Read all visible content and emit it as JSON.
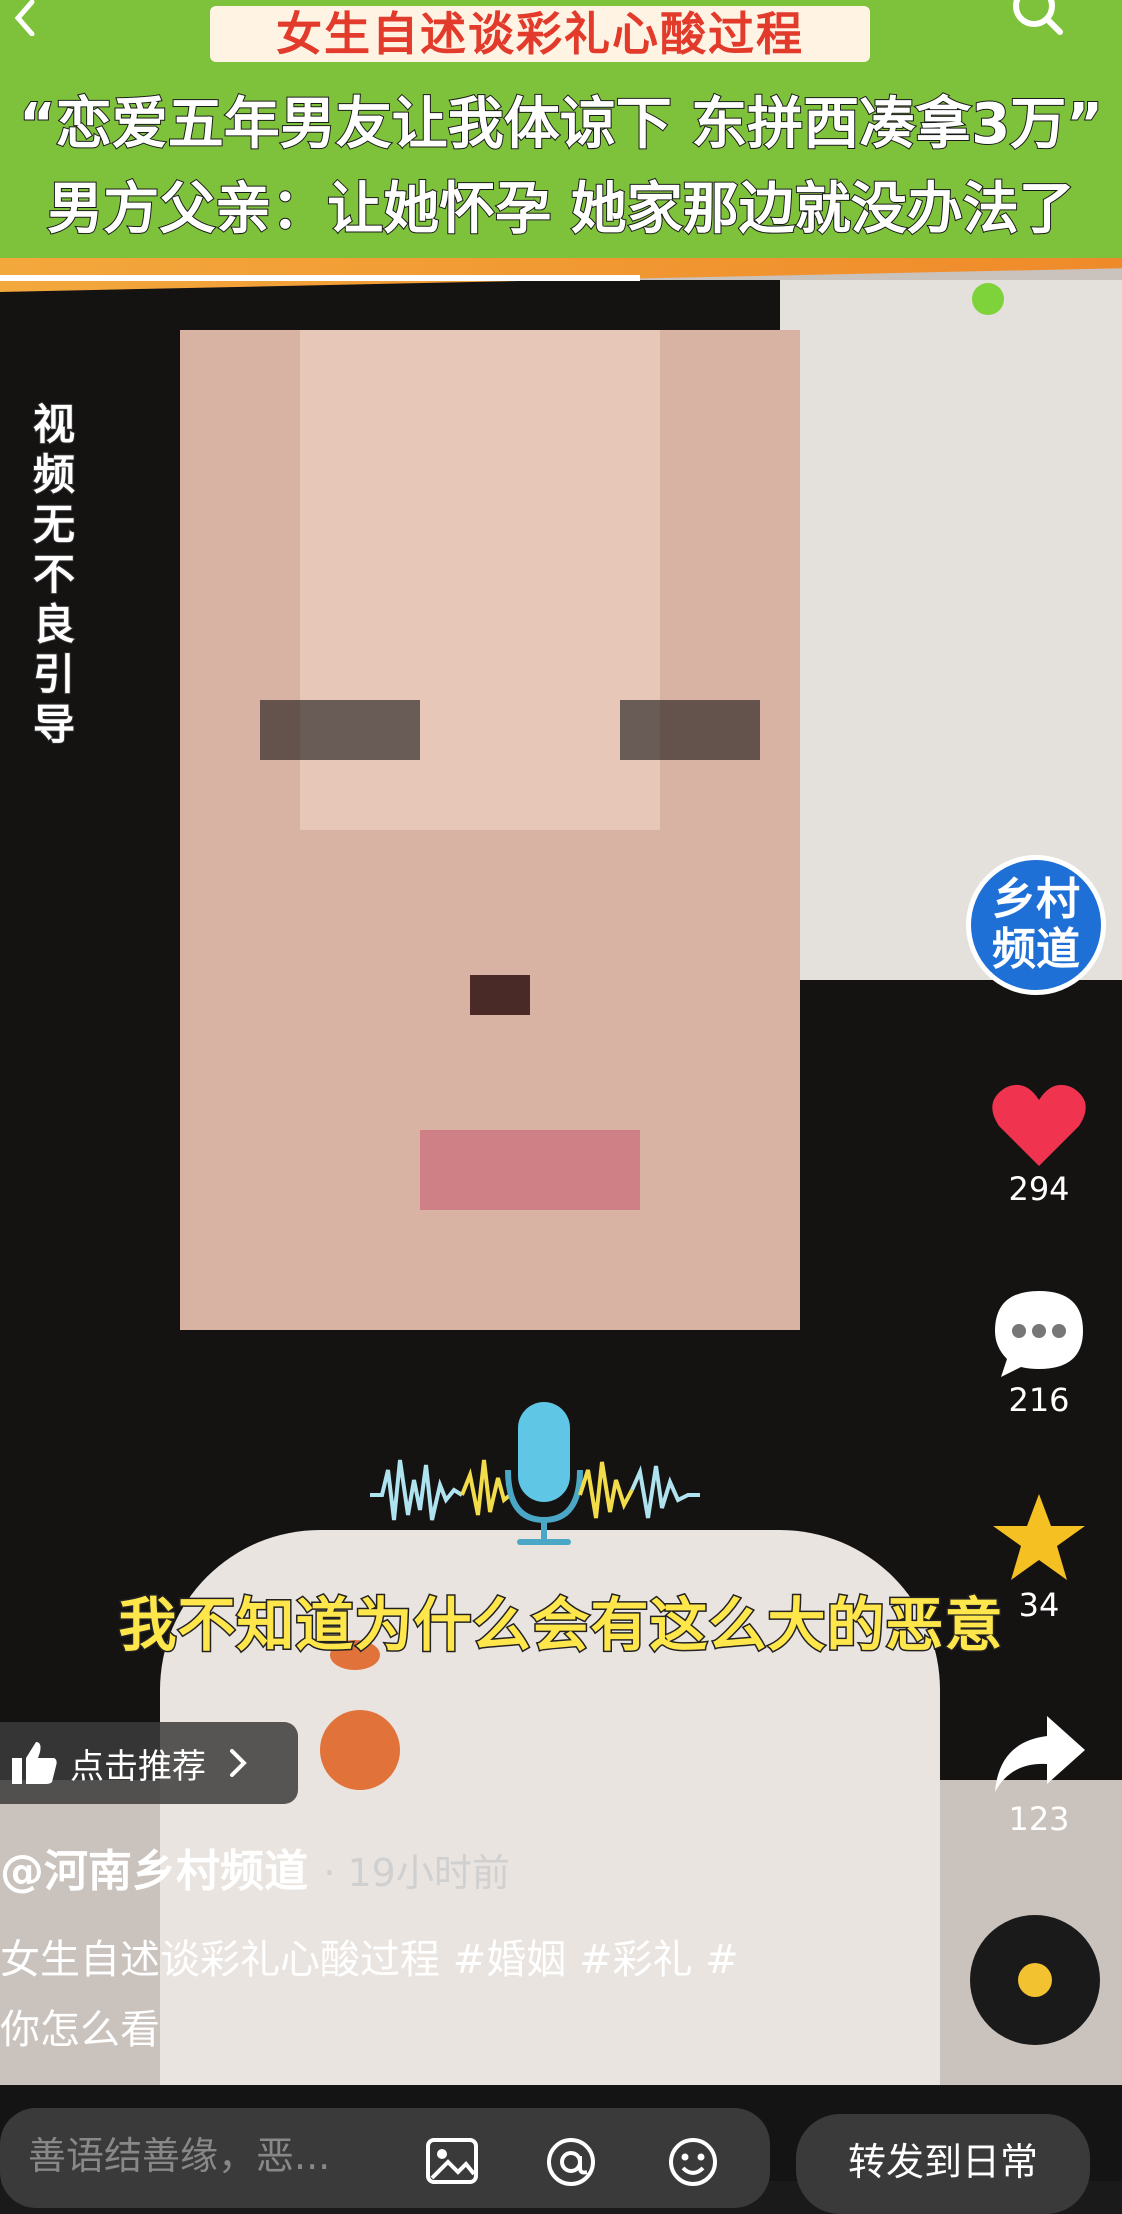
{
  "banner": {
    "title": "女生自述谈彩礼心酸过程",
    "line1": "“恋爱五年男友让我体谅下 东拼西凑拿3万”",
    "line2": "男方父亲：让她怀孕 她家那边就没办法了"
  },
  "watermark": {
    "vertical_text": "视频无不良引导"
  },
  "subtitle": "我不知道为什么会有这么大的恶意",
  "channel": {
    "avatar_line1": "乡村",
    "avatar_line2": "频道"
  },
  "actions": {
    "likes": "294",
    "comments": "216",
    "favorites": "34",
    "shares": "123"
  },
  "recommend": {
    "label": "点击推荐"
  },
  "post": {
    "author": "@河南乡村频道",
    "time": "19小时前",
    "description_line1": "女生自述谈彩礼心酸过程 #婚姻  #彩礼  #",
    "description_line2": "你怎么看"
  },
  "bottom_bar": {
    "input_placeholder": "善语结善缘，恶...",
    "forward_label": "转发到日常"
  },
  "icons": [
    "back-icon",
    "search-icon",
    "microphone-icon",
    "heart-icon",
    "comment-icon",
    "star-icon",
    "share-icon",
    "thumbs-up-icon",
    "chevron-right-icon",
    "music-disc-icon",
    "image-icon",
    "at-icon",
    "emoji-icon"
  ],
  "colors": {
    "banner_green": "#7ec23c",
    "title_red": "#e23a2b",
    "subtitle_yellow": "#ffe64b",
    "like_red": "#f0344f",
    "star_yellow": "#f5c022",
    "avatar_blue": "#1e6fd6"
  }
}
